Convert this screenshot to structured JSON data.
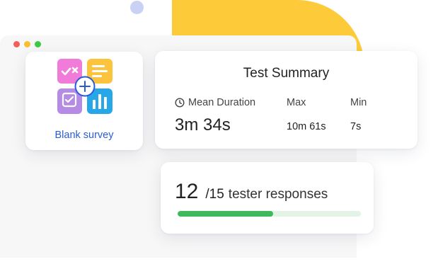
{
  "blank_survey": {
    "label": "Blank survey",
    "icon": "survey-template-icon"
  },
  "summary": {
    "title": "Test Summary",
    "mean": {
      "label": "Mean Duration",
      "value": "3m 34s",
      "icon": "clock-icon"
    },
    "max": {
      "label": "Max",
      "value": "10m 61s"
    },
    "min": {
      "label": "Min",
      "value": "7s"
    }
  },
  "responses": {
    "count": "12",
    "total": "/15",
    "text": "tester responses",
    "progress": 0.52
  },
  "colors": {
    "accent_blue": "#2a5bd7",
    "progress_green": "#3dbb5c",
    "blob_yellow": "#fdcb3a",
    "dot_lavender": "#c9d2f5"
  }
}
